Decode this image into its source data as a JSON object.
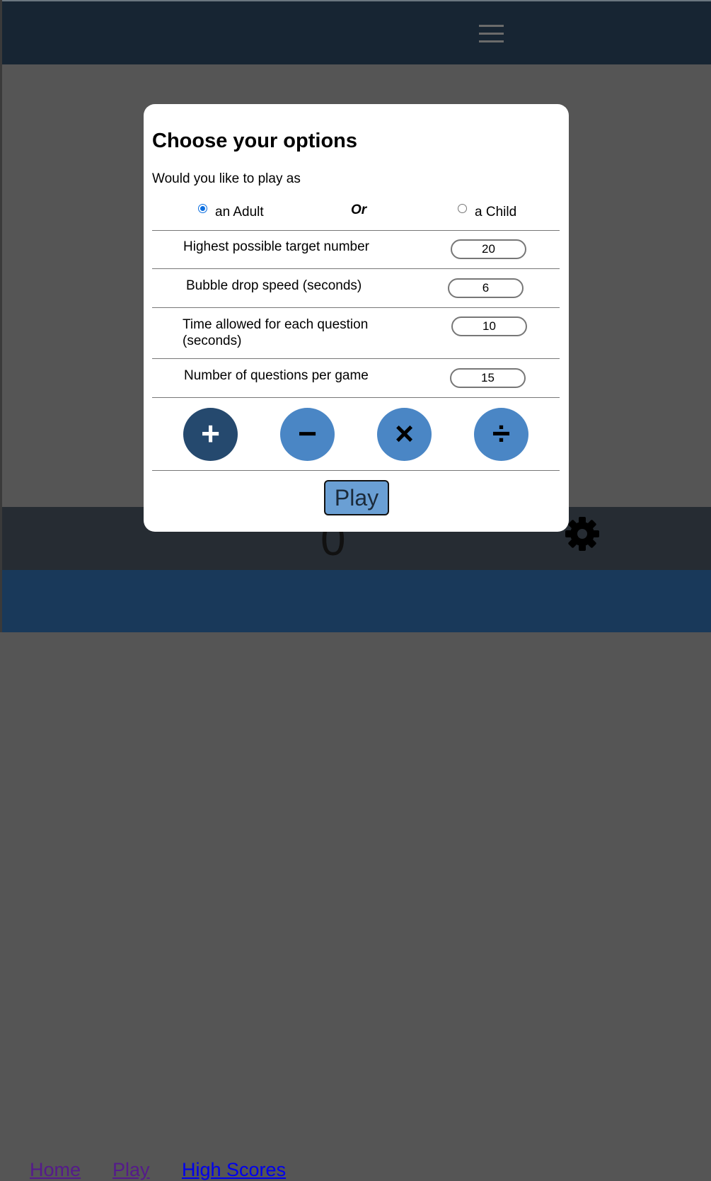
{
  "header": {
    "menu_icon": "hamburger-menu-icon"
  },
  "score": {
    "value": "0",
    "settings_icon": "gear-icon"
  },
  "footer": {
    "links": [
      "Home",
      "Play",
      "High Scores"
    ]
  },
  "modal": {
    "title": "Choose your options",
    "prompt": "Would you like to play as",
    "player_options": {
      "adult": "an Adult",
      "or": "Or",
      "child": "a Child",
      "selected": "adult"
    },
    "settings": [
      {
        "label": "Highest possible target number",
        "value": "20"
      },
      {
        "label": "Bubble drop speed (seconds)",
        "value": "6"
      },
      {
        "label": "Time allowed for each question (seconds)",
        "value": "10"
      },
      {
        "label": "Number of questions per game",
        "value": "15"
      }
    ],
    "operations": [
      "+",
      "−",
      "×",
      "÷"
    ],
    "active_operation": "+",
    "play_label": "Play"
  },
  "colors": {
    "header": "#172533",
    "overlay": "#555555",
    "score_bar": "#262c33",
    "footer": "#19395a",
    "op_button": "#4a86c5",
    "op_button_active": "#25496e",
    "play_button": "#6a9fd4"
  }
}
